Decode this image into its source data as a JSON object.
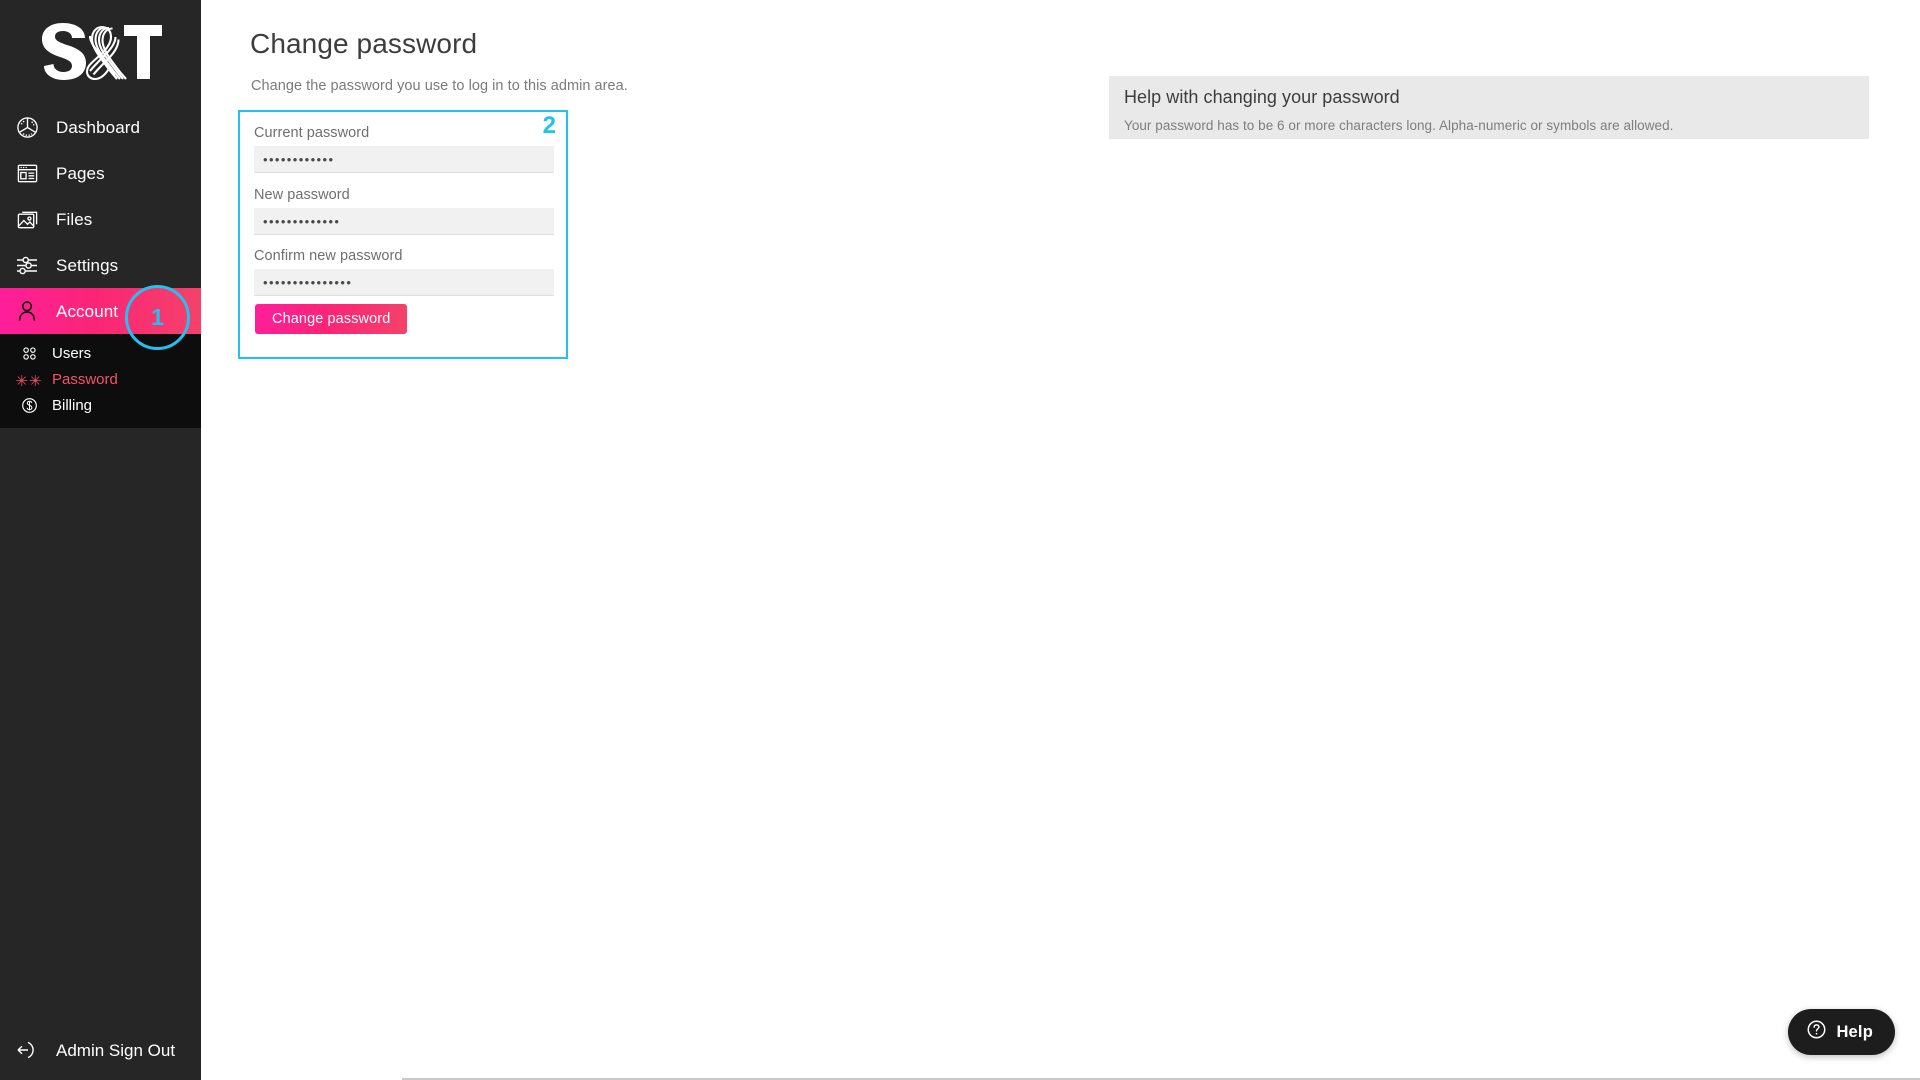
{
  "brand": {
    "logo_text": "S&T",
    "logo_alt": "S&T logo"
  },
  "sidebar": {
    "items": [
      {
        "label": "Dashboard",
        "icon": "dashboard-icon",
        "active": false
      },
      {
        "label": "Pages",
        "icon": "pages-icon",
        "active": false
      },
      {
        "label": "Files",
        "icon": "files-icon",
        "active": false
      },
      {
        "label": "Settings",
        "icon": "settings-icon",
        "active": false
      },
      {
        "label": "Account",
        "icon": "account-icon",
        "active": true
      }
    ],
    "submenu": [
      {
        "label": "Users",
        "icon": "users-grid-icon",
        "current": false
      },
      {
        "label": "Password",
        "icon": "asterisks-icon",
        "current": true
      },
      {
        "label": "Billing",
        "icon": "dollar-circle-icon",
        "current": false
      }
    ],
    "sign_out": {
      "label": "Admin Sign Out",
      "icon": "sign-out-icon"
    }
  },
  "main": {
    "title": "Change password",
    "subtitle": "Change the password you use to log in to this admin area.",
    "form": {
      "fields": [
        {
          "label": "Current password",
          "value": "••••••••••••",
          "placeholder": ""
        },
        {
          "label": "New password",
          "value": "•••••••••••••",
          "placeholder": ""
        },
        {
          "label": "Confirm new password",
          "value": "•••••••••••••••",
          "placeholder": ""
        }
      ],
      "submit_label": "Change password"
    },
    "help_panel": {
      "title": "Help with changing your password",
      "body": "Your password has to be 6 or more characters long. Alpha-numeric or symbols are allowed."
    }
  },
  "annotations": [
    {
      "number": "1",
      "target": "sidebar-item-account"
    },
    {
      "number": "2",
      "target": "change-password-form"
    }
  ],
  "help_fab": {
    "label": "Help",
    "icon": "question-circle-icon"
  },
  "colors": {
    "accent_pink": "#ff1e9a",
    "accent_red": "#f4426a",
    "annotation_cyan": "#22c1f0",
    "sidebar_bg": "#262626",
    "submenu_bg": "#0d0d0d",
    "panel_bg": "#e9e9e9",
    "password_link": "#f4516c"
  }
}
